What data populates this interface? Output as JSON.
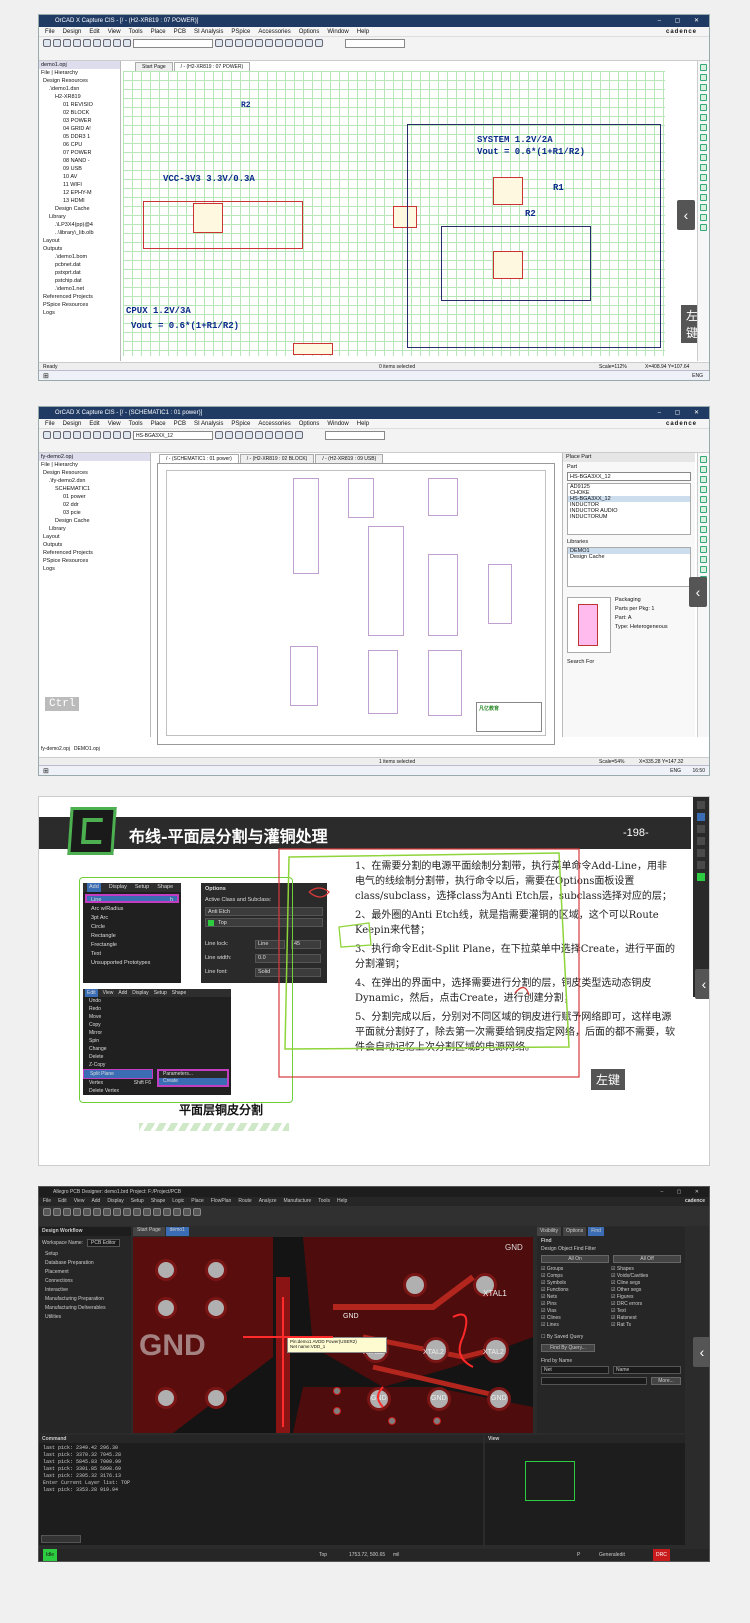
{
  "p1": {
    "title": "OrCAD X Capture CIS - [/ - (H2-XR819 : 07 POWER)]",
    "menus": [
      "File",
      "Design",
      "Edit",
      "View",
      "Tools",
      "Place",
      "PCB",
      "SI Analysis",
      "PSpice",
      "Accessories",
      "Options",
      "Window",
      "Help"
    ],
    "brand": "cadence",
    "tab_start": "Start Page",
    "tab_active": "/ - (H2-XR819 : 07 POWER)",
    "project_file": "demo1.opj",
    "tree_tabs": [
      "File",
      "Hierarchy"
    ],
    "tree": [
      "Design Resources",
      ".\\demo1.dsn",
      "H2-XR819",
      "01 REVISIO",
      "02 BLOCK",
      "03 POWER",
      "04 GRID A!",
      "05 DDR3 1",
      "06 CPU",
      "07 POWER",
      "08 NAND -",
      "09 USB",
      "10 AV",
      "11 WIFI",
      "12 EPHY-M",
      "13 HDMI",
      "Design Cache",
      "Library",
      ".\\LP3X4(pp)@4",
      "..\\library\\_lib.olb",
      "Layout",
      "Outputs",
      ".\\demo1.bom",
      "pcbnet.dat",
      "pstxprt.dat",
      "pstchip.dat",
      ".\\demo1.net",
      "Referenced Projects",
      "PSpice Resources",
      "Logs"
    ],
    "sch_block1_title": "VCC-3V3 3.3V/0.3A",
    "sch_block2_title": "SYSTEM 1.2V/2A",
    "sch_block2_formula": "Vout = 0.6*(1+R1/R2)",
    "sch_block3_title": "CPUX 1.2V/3A",
    "sch_block3_formula": "Vout = 0.6*(1+R1/R2)",
    "ref_r1": "R1",
    "ref_r2": "R2",
    "ref_r2_left": "R2",
    "status_left": "Ready",
    "status_mid": "0 items selected",
    "status_scale": "Scale=112%",
    "status_xy": "X=408.94  Y=107.64",
    "overlay": "左键",
    "taskbar_lang": "ENG"
  },
  "p2": {
    "title": "OrCAD X Capture CIS - [/ - (SCHEMATIC1 : 01 power)]",
    "menus": [
      "File",
      "Design",
      "Edit",
      "View",
      "Tools",
      "Place",
      "PCB",
      "SI Analysis",
      "PSpice",
      "Accessories",
      "Options",
      "Window",
      "Help"
    ],
    "brand": "cadence",
    "part_combo": "HS-BGA3XX_12",
    "project_file": "fy-demo2.opj",
    "tree_tabs": [
      "File",
      "Hierarchy"
    ],
    "tree": [
      "Design Resources",
      ".\\fy-demo2.dsn",
      "SCHEMATIC1",
      "01 power",
      "02 ddr",
      "03 pcie",
      "Design Cache",
      "Library",
      "Layout",
      "Outputs",
      "Referenced Projects",
      "PSpice Resources",
      "Logs"
    ],
    "tabs": [
      "/ - (SCHEMATIC1 : 01 power)",
      "/ - (H2-XR819 : 02 BLOCK)",
      "/ - (H2-XR819 : 09 USB)"
    ],
    "place_part_title": "Place Part",
    "part_label": "Part",
    "part_value": "HS-BGA3XX_12",
    "part_list": [
      "AD9125",
      "CHOKE",
      "HS-BGA3XX_12",
      "INDUCTOR",
      "INDUCTOR AUDIO",
      "INDUCTORUM"
    ],
    "libraries_label": "Libraries",
    "libraries": [
      "DEMO1",
      "Design Cache"
    ],
    "packaging_label": "Packaging",
    "parts_per_pkg": "Parts per Pkg: 1",
    "part_field": "Part: A",
    "type_field": "Type: Heterogeneous",
    "search_for": "Search For",
    "title_block_logo": "凡亿教育",
    "overlay": "Ctrl",
    "bottom_tabs": [
      "fy-demo2.opj",
      "DEMO1.opj"
    ],
    "status_mid": "1 items selected",
    "status_scale": "Scale=54%",
    "status_xy": "X=335.28  Y=147.32",
    "taskbar_lang": "ENG",
    "taskbar_time": "16:50"
  },
  "p3": {
    "title": "布线-平面层分割与灌铜处理",
    "page_num": "-198-",
    "caption": "平面层铜皮分割",
    "menu_tabs": [
      "Add",
      "Display",
      "Setup",
      "Shape"
    ],
    "add_menu": [
      "Line",
      "Arc w/Radius",
      "3pt Arc",
      "Circle",
      "Rectangle",
      "Frectangle",
      "Text",
      "Unsupported Prototypes"
    ],
    "add_menu_shortcut": "h",
    "options_title": "Options",
    "options_active_label": "Active Class and Subclass:",
    "options_class": "Anti Etch",
    "options_subclass": "Top",
    "options_line_lock_label": "Line lock:",
    "options_line_lock": "Line",
    "options_angle": "45",
    "options_width_label": "Line width:",
    "options_width": "0.0",
    "options_font_label": "Line font:",
    "options_font": "Solid",
    "edit_tabs": [
      "Edit",
      "View",
      "Add",
      "Display",
      "Setup",
      "Shape"
    ],
    "edit_menu": [
      "Undo",
      "Redo",
      "Move",
      "Copy",
      "Mirror",
      "Spin",
      "Change",
      "Delete",
      "Z-Copy",
      "Split Plane",
      "Vertex",
      "Delete Vertex"
    ],
    "split_sub": [
      "Parameters...",
      "Create"
    ],
    "edit_shortcuts": [
      "",
      "",
      "",
      "",
      "",
      "",
      "",
      "",
      "",
      "",
      "Shift F6",
      ""
    ],
    "steps": [
      "1、在需要分割的电源平面绘制分割带，执行菜单命令Add-Line，用非电气的线绘制分割带，执行命令以后，需要在Options面板设置class/subclass，选择class为Anti Etch层，subclass选择对应的层；",
      "2、最外圈的Anti Etch线，就是指需要灌铜的区域，这个可以Route Keepin来代替；",
      "3、执行命令Edit-Split Plane，在下拉菜单中选择Create，进行平面的分割灌铜；",
      "4、在弹出的界面中，选择需要进行分割的层，铜皮类型选动态铜皮Dynamic，然后，点击Create，进行创建分割；",
      "5、分割完成以后，分别对不同区域的铜皮进行赋予网络即可，这样电源平面就分割好了，除去第一次需要给铜皮指定网络，后面的都不需要，软件会自动记忆上次分割区域的电源网络。"
    ],
    "overlay": "左键"
  },
  "p4": {
    "title": "Allegro PCB Designer: demo1.brd  Project: F:/Project/PCB",
    "menus": [
      "File",
      "Edit",
      "View",
      "Add",
      "Display",
      "Setup",
      "Shape",
      "Logic",
      "Place",
      "FlowPlan",
      "Route",
      "Analyze",
      "Manufacture",
      "Tools",
      "Help"
    ],
    "brand": "cadence",
    "workflow_title": "Design Workflow",
    "workspace_label": "Workspace Name:",
    "workspace_value": "PCB Editor",
    "workflow_items": [
      "Setup",
      "Database Preparation",
      "Placement",
      "Connections",
      "Interactive",
      "Manufacturing Preparation",
      "Manufacturing Deliverables",
      "Utilities"
    ],
    "canvas_tabs": [
      "Start Page",
      "demo1"
    ],
    "net_labels": [
      "GND",
      "GND",
      "XTAL1",
      "XTAL2",
      "XTAL2",
      "XTAL2",
      "GND",
      "GND",
      "GND",
      "GND"
    ],
    "tooltip_lines": [
      "Pin:demo1 AVDD  Power(USER2)",
      "Net name:VDD_1"
    ],
    "rp_tabs": [
      "Visibility",
      "Options",
      "Find"
    ],
    "find_title": "Find",
    "find_subtitle": "Design Object Find Filter",
    "find_btns": [
      "All On",
      "All Off"
    ],
    "find_left": [
      "Groups",
      "Comps",
      "Symbols",
      "Functions",
      "Nets",
      "Pins",
      "Vias",
      "Clines",
      "Lines",
      "Shapes",
      "Voids/Cavities",
      "Cline segs",
      "Other segs",
      "Figures",
      "DRC errors",
      "Text",
      "Ratsnest",
      "Rat Ts"
    ],
    "saved_query": "By Saved Query",
    "by_query_btn": "Find By Query...",
    "find_by_name": "Find by Name",
    "find_name_type": "Net",
    "find_name_mode": "Name",
    "more_btn": "More...",
    "command_title": "Command",
    "command_lines": [
      "last pick: 2349.42 296.30",
      "last pick: 3370.32 7045.28",
      "last pick: 5845.83 7009.99",
      "last pick: 3301.85 5098.69",
      "last pick: 2305.32 3176.13",
      "Enter Current Layer list: TOP",
      "last pick: 3353.28 919.94"
    ],
    "view_title": "View",
    "status_mode": "Idle",
    "status_layer": "Top",
    "status_coords": "1753.72, 500.65",
    "status_unit": "mil",
    "status_gen": "Generaledit",
    "status_dc": "DRC",
    "status_p": "P"
  }
}
